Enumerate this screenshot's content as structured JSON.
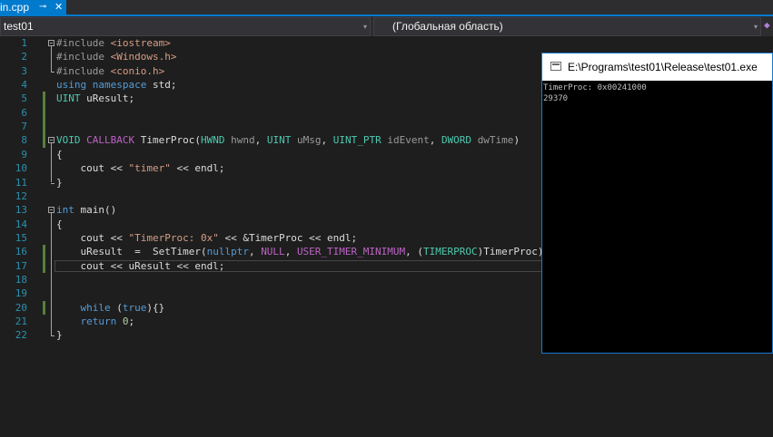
{
  "tab": {
    "label": "in.cpp",
    "pin_glyph": "⊸",
    "close_glyph": "✕"
  },
  "navbar": {
    "project": "test01",
    "scope": "(Глобальная область)",
    "dropdown_glyph": "▾",
    "method_icon": "method-icon"
  },
  "editor": {
    "lines": [
      {
        "n": "1",
        "tokens": [
          {
            "t": "#include ",
            "c": "pp"
          },
          {
            "t": "<iostream>",
            "c": "inc"
          }
        ]
      },
      {
        "n": "2",
        "tokens": [
          {
            "t": "#include ",
            "c": "pp"
          },
          {
            "t": "<Windows.h>",
            "c": "inc"
          }
        ]
      },
      {
        "n": "3",
        "tokens": [
          {
            "t": "#include ",
            "c": "pp"
          },
          {
            "t": "<conio.h>",
            "c": "inc"
          }
        ]
      },
      {
        "n": "4",
        "tokens": [
          {
            "t": "using ",
            "c": "kw"
          },
          {
            "t": "namespace ",
            "c": "kw"
          },
          {
            "t": "std;",
            "c": "plain"
          }
        ]
      },
      {
        "n": "5",
        "tokens": [
          {
            "t": "UINT ",
            "c": "ty"
          },
          {
            "t": "uResult;",
            "c": "plain"
          }
        ]
      },
      {
        "n": "6",
        "tokens": []
      },
      {
        "n": "7",
        "tokens": []
      },
      {
        "n": "8",
        "tokens": [
          {
            "t": "VOID ",
            "c": "ty"
          },
          {
            "t": "CALLBACK ",
            "c": "mac"
          },
          {
            "t": "TimerProc(",
            "c": "plain"
          },
          {
            "t": "HWND ",
            "c": "ty"
          },
          {
            "t": "hwnd",
            "c": "prm"
          },
          {
            "t": ", ",
            "c": "plain"
          },
          {
            "t": "UINT ",
            "c": "ty"
          },
          {
            "t": "uMsg",
            "c": "prm"
          },
          {
            "t": ", ",
            "c": "plain"
          },
          {
            "t": "UINT_PTR ",
            "c": "ty"
          },
          {
            "t": "idEvent",
            "c": "prm"
          },
          {
            "t": ", ",
            "c": "plain"
          },
          {
            "t": "DWORD ",
            "c": "ty"
          },
          {
            "t": "dwTime",
            "c": "prm"
          },
          {
            "t": ")",
            "c": "plain"
          }
        ]
      },
      {
        "n": "9",
        "tokens": [
          {
            "t": "{",
            "c": "plain"
          }
        ]
      },
      {
        "n": "10",
        "tokens": [
          {
            "t": "    cout << ",
            "c": "plain"
          },
          {
            "t": "\"timer\"",
            "c": "str"
          },
          {
            "t": " << endl;",
            "c": "plain"
          }
        ]
      },
      {
        "n": "11",
        "tokens": [
          {
            "t": "}",
            "c": "plain"
          }
        ]
      },
      {
        "n": "12",
        "tokens": []
      },
      {
        "n": "13",
        "tokens": [
          {
            "t": "int ",
            "c": "kw"
          },
          {
            "t": "main()",
            "c": "plain"
          }
        ]
      },
      {
        "n": "14",
        "tokens": [
          {
            "t": "{",
            "c": "plain"
          }
        ]
      },
      {
        "n": "15",
        "tokens": [
          {
            "t": "    cout << ",
            "c": "plain"
          },
          {
            "t": "\"TimerProc: 0x\"",
            "c": "str"
          },
          {
            "t": " << &TimerProc << endl;",
            "c": "plain"
          }
        ]
      },
      {
        "n": "16",
        "tokens": [
          {
            "t": "    uResult  =  SetTimer(",
            "c": "plain"
          },
          {
            "t": "nullptr",
            "c": "kw"
          },
          {
            "t": ", ",
            "c": "plain"
          },
          {
            "t": "NULL",
            "c": "mac"
          },
          {
            "t": ", ",
            "c": "plain"
          },
          {
            "t": "USER_TIMER_MINIMUM",
            "c": "mac"
          },
          {
            "t": ", (",
            "c": "plain"
          },
          {
            "t": "TIMERPROC",
            "c": "ty"
          },
          {
            "t": ")TimerProc);",
            "c": "plain"
          }
        ]
      },
      {
        "n": "17",
        "tokens": [
          {
            "t": "    cout << uResult << endl;",
            "c": "plain"
          }
        ]
      },
      {
        "n": "18",
        "tokens": []
      },
      {
        "n": "19",
        "tokens": []
      },
      {
        "n": "20",
        "tokens": [
          {
            "t": "    ",
            "c": "plain"
          },
          {
            "t": "while ",
            "c": "kw"
          },
          {
            "t": "(",
            "c": "plain"
          },
          {
            "t": "true",
            "c": "kw"
          },
          {
            "t": "){}",
            "c": "plain"
          }
        ]
      },
      {
        "n": "21",
        "tokens": [
          {
            "t": "    ",
            "c": "plain"
          },
          {
            "t": "return ",
            "c": "kw"
          },
          {
            "t": "0",
            "c": "num"
          },
          {
            "t": ";",
            "c": "plain"
          }
        ]
      },
      {
        "n": "22",
        "tokens": [
          {
            "t": "}",
            "c": "plain"
          }
        ]
      }
    ],
    "changed_lines": [
      "5",
      "6",
      "7",
      "8",
      "16",
      "17",
      "20"
    ],
    "fold_lines": [
      "1",
      "8",
      "13"
    ],
    "current_line": "17"
  },
  "console": {
    "title": "E:\\Programs\\test01\\Release\\test01.exe",
    "output": [
      "TimerProc: 0x00241000",
      "29370"
    ]
  }
}
